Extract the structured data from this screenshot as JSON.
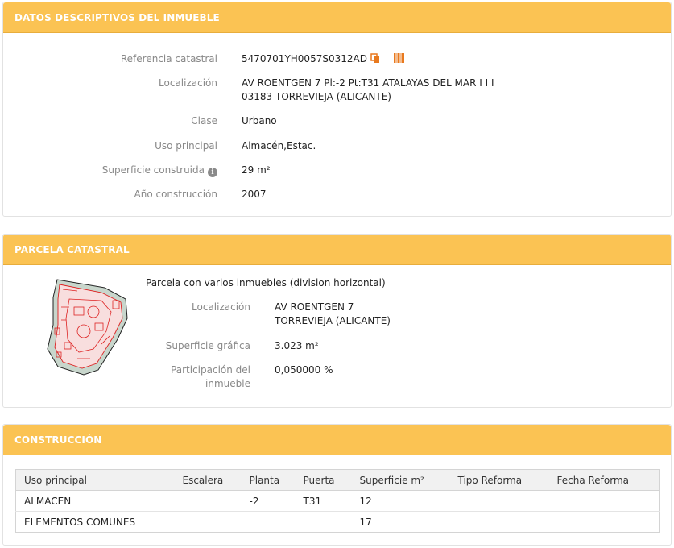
{
  "datos": {
    "title": "DATOS DESCRIPTIVOS DEL INMUEBLE",
    "ref_label": "Referencia catastral",
    "ref_value": "5470701YH0057S0312AD",
    "loc_label": "Localización",
    "loc_line1": "AV ROENTGEN 7 Pl:-2 Pt:T31 ATALAYAS DEL MAR I I I",
    "loc_line2": "03183 TORREVIEJA (ALICANTE)",
    "clase_label": "Clase",
    "clase_value": "Urbano",
    "uso_label": "Uso principal",
    "uso_value": "Almacén,Estac.",
    "sup_label": "Superficie construida",
    "sup_value": "29 m²",
    "anio_label": "Año construcción",
    "anio_value": "2007"
  },
  "parcela": {
    "title": "PARCELA CATASTRAL",
    "heading": "Parcela con varios inmuebles (division horizontal)",
    "loc_label": "Localización",
    "loc_line1": "AV ROENTGEN 7",
    "loc_line2": "TORREVIEJA (ALICANTE)",
    "sup_label": "Superficie gráfica",
    "sup_value": "3.023 m²",
    "part_label_1": "Participación del",
    "part_label_2": "inmueble",
    "part_value": "0,050000 %"
  },
  "construccion": {
    "title": "CONSTRUCCIÓN",
    "columns": [
      "Uso principal",
      "Escalera",
      "Planta",
      "Puerta",
      "Superficie m²",
      "Tipo Reforma",
      "Fecha Reforma"
    ],
    "rows": [
      [
        "ALMACEN",
        "",
        "-2",
        "T31",
        "12",
        "",
        ""
      ],
      [
        "ELEMENTOS COMUNES",
        "",
        "",
        "",
        "17",
        "",
        ""
      ]
    ]
  },
  "colors": {
    "header_bg": "#fbc353",
    "accent_icon": "#e8791e"
  },
  "icons": [
    "copy-icon",
    "barcode-icon",
    "info-icon",
    "parcel-map"
  ]
}
